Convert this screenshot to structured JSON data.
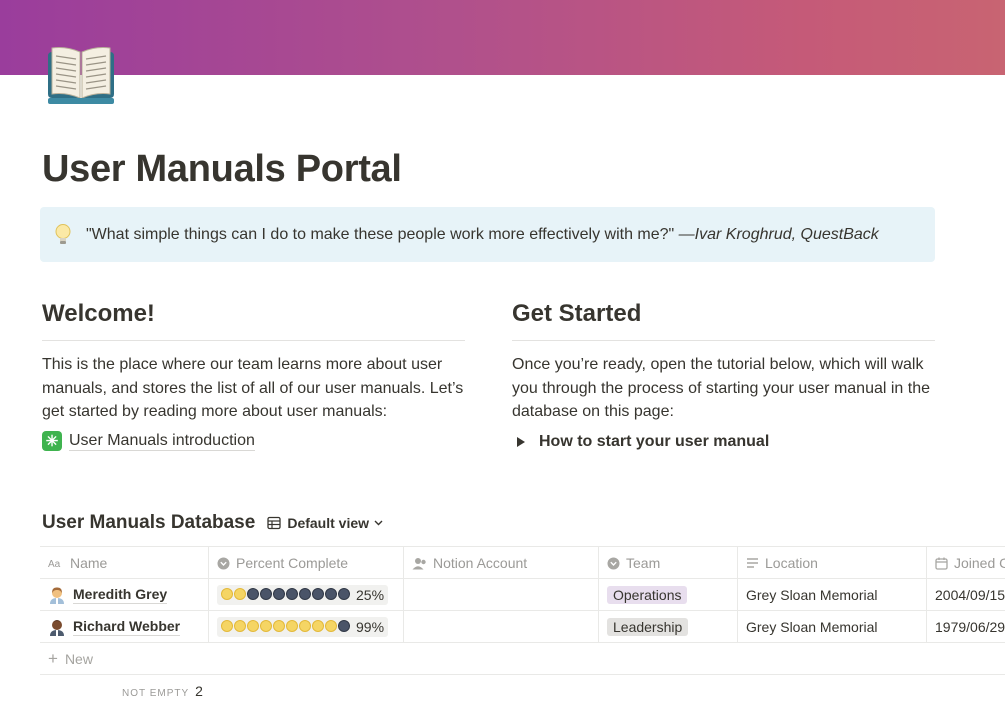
{
  "cover": {
    "gradient_start": "#9a3d9c",
    "gradient_end": "#c86472"
  },
  "page": {
    "icon": "open-book-icon",
    "title": "User Manuals Portal"
  },
  "callout": {
    "icon": "light-bulb-icon",
    "quote": "\"What simple things can I do to make these people work more effectively with me?\" ",
    "attribution": "—Ivar Kroghrud, QuestBack",
    "background": "#e7f3f8"
  },
  "welcome": {
    "heading": "Welcome!",
    "body": "This is the place where our team learns more about user manuals, and stores the list of all of our user manuals. Let’s get started by reading more about user manuals:",
    "link_label": "User Manuals introduction",
    "link_icon": "sparkle-icon"
  },
  "get_started": {
    "heading": "Get Started",
    "body": "Once you’re ready, open the tutorial below, which will walk you through the process of starting your user manual in the database on this page:",
    "toggle_label": "How to start your user manual"
  },
  "database": {
    "title": "User Manuals Database",
    "view_label": "Default view",
    "columns": [
      "Name",
      "Percent Complete",
      "Notion Account",
      "Team",
      "Location",
      "Joined C"
    ],
    "rows": [
      {
        "name": "Meredith Grey",
        "percent": "25%",
        "progress": 0.25,
        "notion_account": "",
        "team": "Operations",
        "team_bg": "#e8deee",
        "location": "Grey Sloan Memorial",
        "joined": "2004/09/15"
      },
      {
        "name": "Richard Webber",
        "percent": "99%",
        "progress": 0.99,
        "notion_account": "",
        "team": "Leadership",
        "team_bg": "#e3e2e0",
        "location": "Grey Sloan Memorial",
        "joined": "1979/06/29"
      }
    ],
    "new_label": "New",
    "footer_label": "NOT EMPTY",
    "footer_value": "2"
  }
}
